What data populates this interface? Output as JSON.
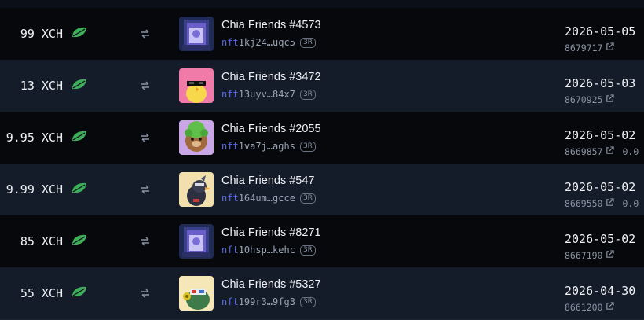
{
  "colors": {
    "accent_link": "#5b6cf0",
    "leaf_green": "#3fae5a"
  },
  "icons": {
    "currency": "chia-leaf-icon",
    "swap": "swap-arrows-icon",
    "link": "external-link-icon"
  },
  "rows": [
    {
      "price": "99 XCH",
      "name": "Chia Friends #4573",
      "id_prefix": "nft",
      "id_rest": "1kj24…uqc5",
      "badge": "3R",
      "date": "2026-05-05",
      "block": "8679717",
      "extra": "",
      "art": "portal"
    },
    {
      "price": "13 XCH",
      "name": "Chia Friends #3472",
      "id_prefix": "nft",
      "id_rest": "13uyv…84x7",
      "badge": "3R",
      "date": "2026-05-03",
      "block": "8670925",
      "extra": "",
      "art": "chick"
    },
    {
      "price": "9.95 XCH",
      "name": "Chia Friends #2055",
      "id_prefix": "nft",
      "id_rest": "1va7j…aghs",
      "badge": "3R",
      "date": "2026-05-02",
      "block": "8669857",
      "extra": "0.0",
      "art": "bear"
    },
    {
      "price": "9.99 XCH",
      "name": "Chia Friends #547",
      "id_prefix": "nft",
      "id_rest": "164um…gcce",
      "badge": "3R",
      "date": "2026-05-02",
      "block": "8669550",
      "extra": "0.0",
      "art": "bird"
    },
    {
      "price": "85 XCH",
      "name": "Chia Friends #8271",
      "id_prefix": "nft",
      "id_rest": "10hsp…kehc",
      "badge": "3R",
      "date": "2026-05-02",
      "block": "8667190",
      "extra": "",
      "art": "portal"
    },
    {
      "price": "55 XCH",
      "name": "Chia Friends #5327",
      "id_prefix": "nft",
      "id_rest": "199r3…9fg3",
      "badge": "3R",
      "date": "2026-04-30",
      "block": "8661200",
      "extra": "",
      "art": "frog"
    }
  ]
}
